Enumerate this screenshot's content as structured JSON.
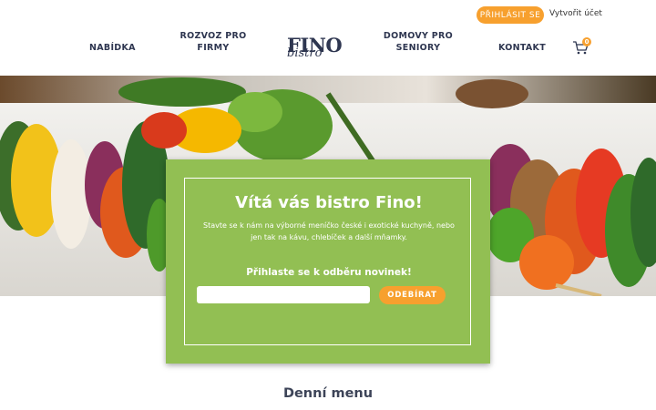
{
  "header": {
    "login_label": "PŘIHLÁSIT SE",
    "register_label": "Vytvořit účet",
    "nav": [
      {
        "label": "NABÍDKA"
      },
      {
        "line1": "ROZVOZ PRO",
        "line2": "FIRMY"
      },
      {
        "line1": "DOMOVY PRO",
        "line2": "SENIORY"
      },
      {
        "label": "KONTAKT"
      }
    ],
    "logo": {
      "main": "FINO",
      "sub": "bistro"
    },
    "cart": {
      "icon": "cart-icon",
      "count": "0"
    }
  },
  "newsletter": {
    "title": "Vítá vás bistro Fino!",
    "description": "Stavte se k nám na výborné meníčko české i exotické kuchyně, nebo jen tak na kávu, chlebíček a další mňamky.",
    "subtitle": "Přihlaste se k odběru novinek!",
    "email_placeholder": "",
    "subscribe_label": "ODEBÍRAT"
  },
  "main": {
    "section_title": "Denní menu"
  },
  "colors": {
    "accent": "#f7a02e",
    "card": "#92bf53",
    "nav_text": "#2e3650"
  }
}
